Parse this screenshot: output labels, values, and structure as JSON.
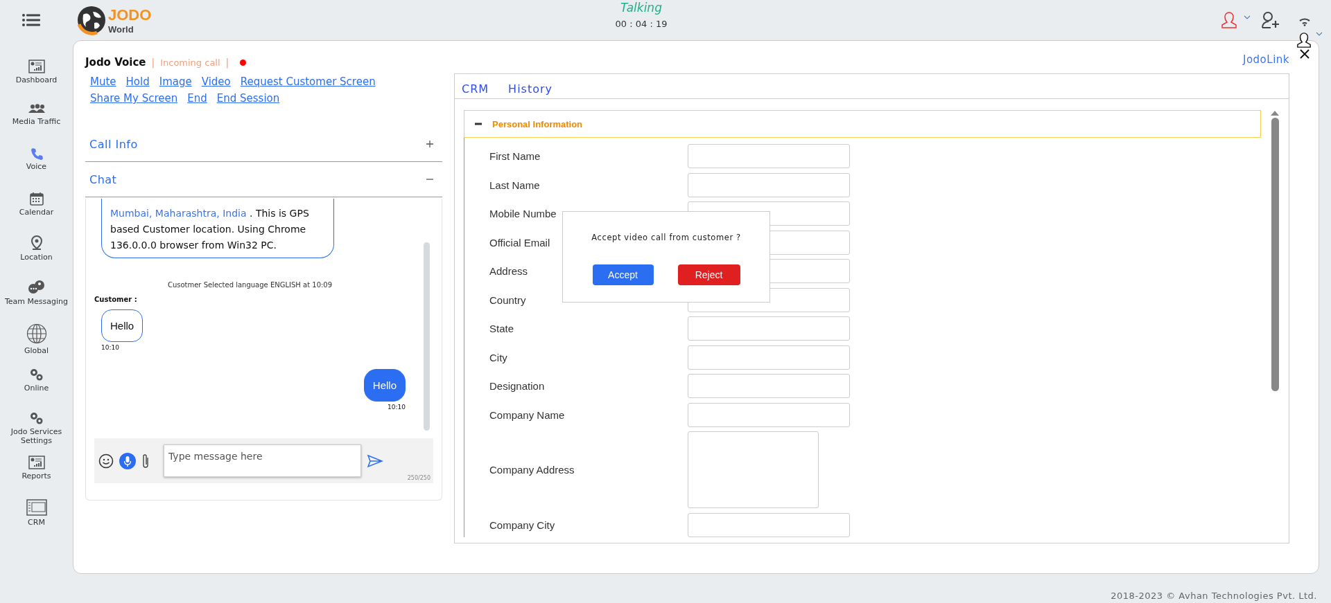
{
  "header": {
    "logo": {
      "line_1": "JODO",
      "line_2": "World"
    },
    "status": "Talking",
    "timer": "00 : 04 : 19"
  },
  "sidebar": {
    "items": [
      {
        "label": "Dashboard",
        "selected": false
      },
      {
        "label": "Media Traffic",
        "selected": false
      },
      {
        "label": "Voice",
        "selected": true
      },
      {
        "label": "Calendar",
        "selected": false
      },
      {
        "label": "Location",
        "selected": false
      },
      {
        "label": "Team Messaging",
        "selected": false
      },
      {
        "label": "Global",
        "selected": false
      },
      {
        "label": "Online",
        "selected": false
      },
      {
        "label": "Jodo Services Settings",
        "selected": false
      },
      {
        "label": "Reports",
        "selected": false
      },
      {
        "label": "CRM",
        "selected": false
      }
    ]
  },
  "voice": {
    "title": "Jodo Voice",
    "separators": [
      "|",
      "|"
    ],
    "state": "Incoming call",
    "actions": [
      [
        "Mute",
        "Hold",
        "Image",
        "Video",
        "Request Customer Screen"
      ],
      [
        "Share My Screen",
        "End",
        "End Session"
      ]
    ],
    "sections": [
      {
        "title": "Call Info",
        "expanded": false
      },
      {
        "title": "Chat",
        "expanded": true
      }
    ],
    "chat": {
      "messages": [
        {
          "kind": "location",
          "place": "Mumbai, Maharashtra, India",
          "text": " . This is GPS based Customer location. Using Chrome 136.0.0.0 browser from Win32 PC."
        },
        {
          "kind": "system",
          "text": "Cusotmer Selected language ENGLISH at 10:09"
        },
        {
          "kind": "sender",
          "text": "Customer :"
        },
        {
          "kind": "incoming",
          "text": "Hello",
          "time": "10:10"
        },
        {
          "kind": "outgoing",
          "text": "Hello",
          "time": "10:10"
        }
      ],
      "input": {
        "placeholder": "Type message here",
        "counter": "250/250"
      }
    }
  },
  "jodolink": "JodoLink",
  "crm": {
    "tabs": [
      {
        "label": "CRM"
      },
      {
        "label": "History"
      }
    ],
    "section": {
      "title": "Personal Information",
      "expanded": true,
      "fields": [
        {
          "label": "First Name",
          "kind": "text"
        },
        {
          "label": "Last Name",
          "kind": "text"
        },
        {
          "label": "Mobile Numbe",
          "kind": "text"
        },
        {
          "label": "Official Email",
          "kind": "text"
        },
        {
          "label": "Address",
          "kind": "text"
        },
        {
          "label": "Country",
          "kind": "text"
        },
        {
          "label": "State",
          "kind": "text"
        },
        {
          "label": "City",
          "kind": "text"
        },
        {
          "label": "Designation",
          "kind": "text"
        },
        {
          "label": "Company Name",
          "kind": "text"
        },
        {
          "label": "Company Address",
          "kind": "textarea"
        },
        {
          "label": "Company City",
          "kind": "text"
        }
      ]
    }
  },
  "dialog": {
    "message": "Accept video call from customer ?",
    "buttons": [
      {
        "label": "Accept",
        "kind": "primary"
      },
      {
        "label": "Reject",
        "kind": "danger"
      }
    ]
  },
  "footer": "2018-2023 © Avhan Technologies Pvt. Ltd."
}
